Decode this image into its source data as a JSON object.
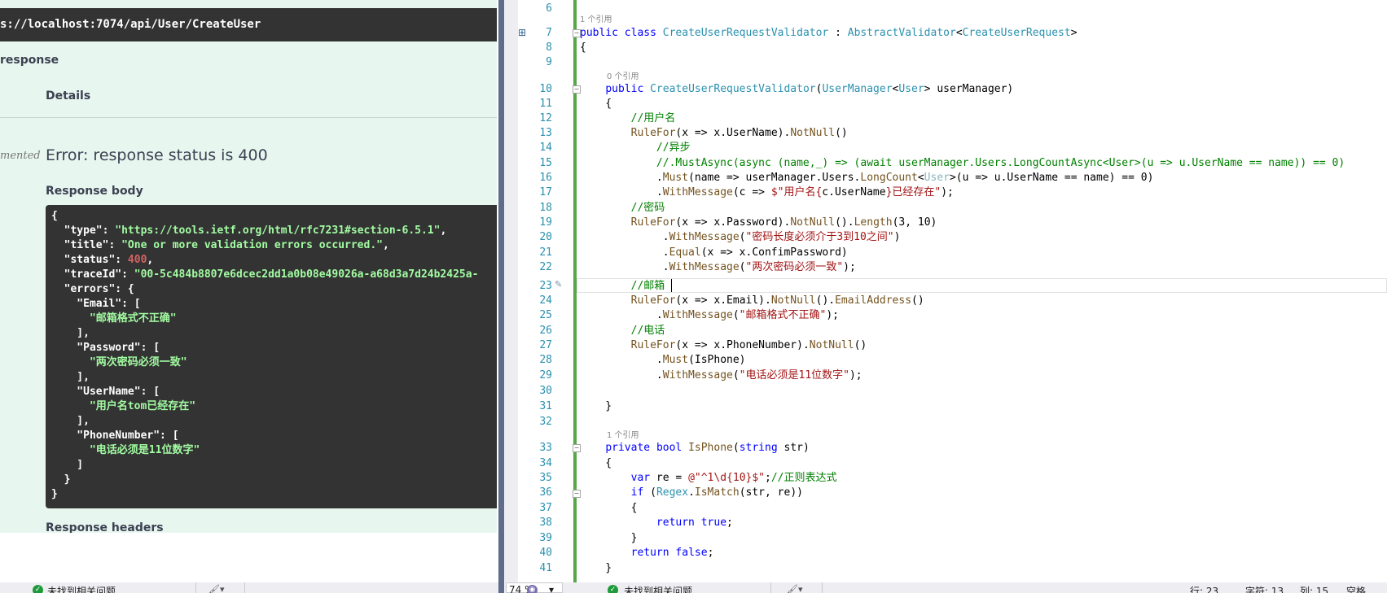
{
  "swagger": {
    "request_url": "s://localhost:7074/api/User/CreateUser",
    "server_response_title": "response",
    "details_header": "Details",
    "code_label": "mented",
    "error_text": "Error: response status is 400",
    "response_body_title": "Response body",
    "response_headers_title": "Response headers",
    "response_body_lines": [
      "{",
      "  \"type\": \"https://tools.ietf.org/html/rfc7231#section-6.5.1\",",
      "  \"title\": \"One or more validation errors occurred.\",",
      "  \"status\": 400,",
      "  \"traceId\": \"00-5c484b8807e6dcec2dd1a0b08e49026a-a68d3a7d24b2425a-",
      "  \"errors\": {",
      "    \"Email\": [",
      "      \"邮箱格式不正确\"",
      "    ],",
      "    \"Password\": [",
      "      \"两次密码必须一致\"",
      "    ],",
      "    \"UserName\": [",
      "      \"用户名tom已经存在\"",
      "    ],",
      "    \"PhoneNumber\": [",
      "      \"电话必须是11位数字\"",
      "    ]",
      "  }",
      "}"
    ]
  },
  "left_status": {
    "issues_text": "未找到相关问题"
  },
  "editor": {
    "ref_labels": {
      "class_refs": "1 个引用",
      "ctor_refs": "0 个引用",
      "method_refs": "1 个引用"
    },
    "lines": [
      {
        "n": "6"
      },
      {
        "n": "7"
      },
      {
        "n": "8"
      },
      {
        "n": "9"
      },
      {
        "n": "10"
      },
      {
        "n": "11"
      },
      {
        "n": "12"
      },
      {
        "n": "13"
      },
      {
        "n": "14"
      },
      {
        "n": "15"
      },
      {
        "n": "16"
      },
      {
        "n": "17"
      },
      {
        "n": "18"
      },
      {
        "n": "19"
      },
      {
        "n": "20"
      },
      {
        "n": "21"
      },
      {
        "n": "22"
      },
      {
        "n": "23"
      },
      {
        "n": "24"
      },
      {
        "n": "25"
      },
      {
        "n": "26"
      },
      {
        "n": "27"
      },
      {
        "n": "28"
      },
      {
        "n": "29"
      },
      {
        "n": "30"
      },
      {
        "n": "31"
      },
      {
        "n": "32"
      },
      {
        "n": "33"
      },
      {
        "n": "34"
      },
      {
        "n": "35"
      },
      {
        "n": "36"
      },
      {
        "n": "37"
      },
      {
        "n": "38"
      },
      {
        "n": "39"
      },
      {
        "n": "40"
      },
      {
        "n": "41"
      }
    ],
    "code": {
      "l7": "public class CreateUserRequestValidator : AbstractValidator<CreateUserRequest>",
      "l8": "{",
      "l10": "    public CreateUserRequestValidator(UserManager<User> userManager)",
      "l11": "    {",
      "l12": "        //用户名",
      "l13": "        RuleFor(x => x.UserName).NotNull()",
      "l14": "            //异步",
      "l15": "            //.MustAsync(async (name,_) => (await userManager.Users.LongCountAsync<User>(u => u.UserName == name)) == 0)",
      "l16": "            .Must(name => userManager.Users.LongCount<User>(u => u.UserName == name) == 0)",
      "l17": "            .WithMessage(c => $\"用户名{c.UserName}已经存在\");",
      "l18": "        //密码",
      "l19": "        RuleFor(x => x.Password).NotNull().Length(3, 10)",
      "l20": "             .WithMessage(\"密码长度必须介于3到10之间\")",
      "l21": "             .Equal(x => x.ConfimPassword)",
      "l22": "             .WithMessage(\"两次密码必须一致\");",
      "l23": "        //邮箱",
      "l24": "        RuleFor(x => x.Email).NotNull().EmailAddress()",
      "l25": "            .WithMessage(\"邮箱格式不正确\");",
      "l26": "        //电话",
      "l27": "        RuleFor(x => x.PhoneNumber).NotNull()",
      "l28": "            .Must(IsPhone)",
      "l29": "            .WithMessage(\"电话必须是11位数字\");",
      "l31": "    }",
      "l33": "    private bool IsPhone(string str)",
      "l34": "    {",
      "l35": "        var re = @\"^1\\d{10}$\";//正则表达式",
      "l36": "        if (Regex.IsMatch(str, re))",
      "l37": "        {",
      "l38": "            return true;",
      "l39": "        }",
      "l40": "        return false;",
      "l41": "    }"
    }
  },
  "right_status": {
    "zoom": "74 %",
    "issues_text": "未找到相关问题",
    "line_label": "行: 23",
    "char_label": "字符: 13",
    "col_label": "列: 15",
    "indent_label": "空格"
  },
  "colors": {
    "swagger_bg": "#e8f6f0",
    "json_bg": "#333333",
    "json_string": "#a2fca2",
    "json_number": "#d36363",
    "vs_keyword": "#0000ff",
    "vs_type": "#2b91af",
    "vs_comment": "#008000",
    "vs_string": "#a31515",
    "vs_method": "#74531f",
    "splitter": "#5f6c8c"
  }
}
